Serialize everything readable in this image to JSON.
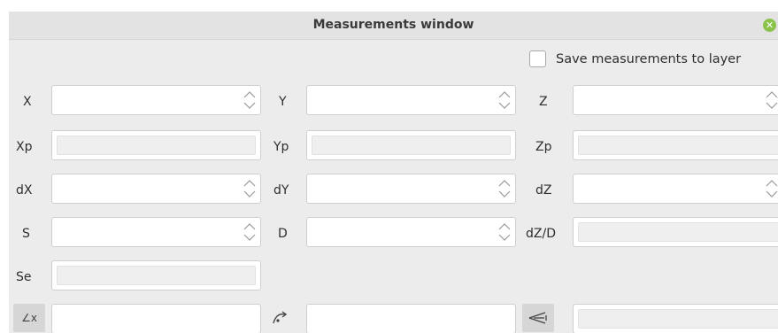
{
  "window": {
    "title": "Measurements window",
    "close_icon": "close-icon"
  },
  "save": {
    "checked": false,
    "label": "Save measurements to layer"
  },
  "labels": {
    "x": "X",
    "y": "Y",
    "z": "Z",
    "xp": "Xp",
    "yp": "Yp",
    "zp": "Zp",
    "dx": "dX",
    "dy": "dY",
    "dz": "dZ",
    "s": "S",
    "d": "D",
    "dzd": "dZ/D",
    "se": "Se"
  },
  "fields": {
    "x": "",
    "y": "",
    "z": "",
    "xp": "",
    "yp": "",
    "zp": "",
    "dx": "",
    "dy": "",
    "dz": "",
    "s": "",
    "d": "",
    "dzd": "",
    "se": "",
    "angle": "",
    "curve": "",
    "sight": ""
  },
  "tools": {
    "angle_icon": "angle-x-icon",
    "angle_text": "∠x",
    "curve_icon": "curve-icon",
    "sight_icon": "sight-line-icon"
  }
}
